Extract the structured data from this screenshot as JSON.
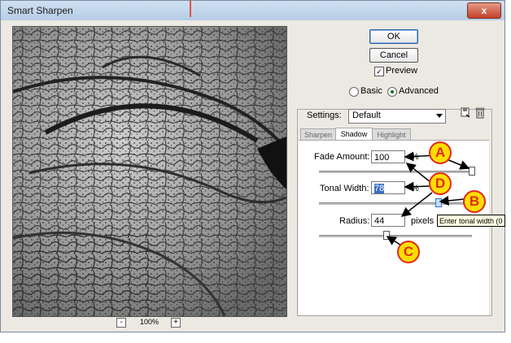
{
  "window": {
    "title": "Smart Sharpen",
    "close_glyph": "x"
  },
  "buttons": {
    "ok": "OK",
    "cancel": "Cancel"
  },
  "preview": {
    "label": "Preview",
    "checked": true,
    "zoom": "100%",
    "zoom_out": "-",
    "zoom_in": "+"
  },
  "mode": {
    "basic": "Basic",
    "advanced": "Advanced",
    "selected": "advanced"
  },
  "settings": {
    "label": "Settings:",
    "value": "Default"
  },
  "tabs": [
    {
      "label": "Sharpen"
    },
    {
      "label": "Shadow"
    },
    {
      "label": "Highlight"
    }
  ],
  "active_tab": "Shadow",
  "shadow": {
    "fade_amount": {
      "label": "Fade Amount:",
      "value": "100",
      "unit": "%",
      "level": 1.0
    },
    "tonal_width": {
      "label": "Tonal Width:",
      "value": "78",
      "unit": "%",
      "level": 0.78
    },
    "radius": {
      "label": "Radius:",
      "value": "44",
      "unit": "pixels",
      "level": 0.44
    }
  },
  "tooltip": "Enter tonal width (0",
  "callouts": [
    "A",
    "B",
    "C",
    "D"
  ],
  "icons": {
    "save": "save-preset-icon",
    "delete": "delete-preset-icon"
  }
}
